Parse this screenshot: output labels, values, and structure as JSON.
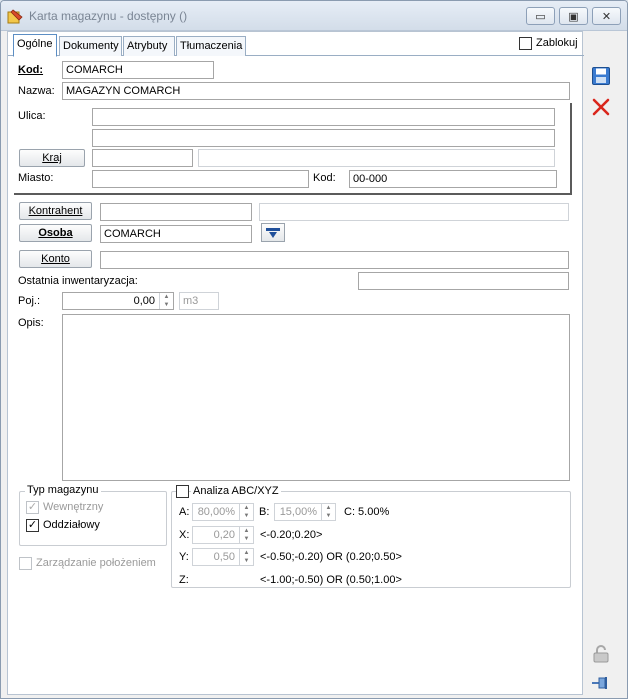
{
  "window": {
    "title": "Karta magazynu - dostępny ()",
    "minimize_glyph": "▭",
    "maximize_glyph": "▣",
    "close_glyph": "✕"
  },
  "tabs": [
    {
      "label": "Ogólne",
      "active": true
    },
    {
      "label": "Dokumenty",
      "active": false
    },
    {
      "label": "Atrybuty",
      "active": false
    },
    {
      "label": "Tłumaczenia",
      "active": false
    }
  ],
  "zablokuj": {
    "label": "Zablokuj",
    "checked": false
  },
  "kod": {
    "label": "Kod:",
    "value": "COMARCH"
  },
  "nazwa": {
    "label": "Nazwa:",
    "value": "MAGAZYN COMARCH"
  },
  "ulica": {
    "label": "Ulica:",
    "line1": "",
    "line2": ""
  },
  "kraj": {
    "button": "Kraj",
    "code": "",
    "name": ""
  },
  "miasto": {
    "label": "Miasto:",
    "value": ""
  },
  "kod_pocztowy": {
    "label": "Kod:",
    "value": "00-000"
  },
  "kontrahent": {
    "button": "Kontrahent",
    "code": "",
    "name": ""
  },
  "osoba": {
    "button": "Osoba",
    "value": "COMARCH"
  },
  "konto": {
    "button": "Konto",
    "value": ""
  },
  "ostatnia_inwentaryzacja": {
    "label": "Ostatnia inwentaryzacja:",
    "value": ""
  },
  "poj": {
    "label": "Poj.:",
    "value": "0,00",
    "unit": "m3"
  },
  "opis": {
    "label": "Opis:",
    "value": ""
  },
  "typ_magazynu": {
    "title": "Typ magazynu",
    "wewnetrzny": {
      "label": "Wewnętrzny",
      "checked": true,
      "disabled": true
    },
    "oddzialowy": {
      "label": "Oddziałowy",
      "checked": true,
      "disabled": false
    }
  },
  "zarzadzanie": {
    "label": "Zarządzanie położeniem",
    "checked": false,
    "disabled": true
  },
  "analiza": {
    "title": "Analiza ABC/XYZ",
    "checked": false,
    "a_label": "A:",
    "a_value": "80,00%",
    "b_label": "B:",
    "b_value": "15,00%",
    "c_text": "C: 5.00%",
    "x_label": "X:",
    "x_value": "0,20",
    "x_range": "<-0.20;0.20>",
    "y_label": "Y:",
    "y_value": "0,50",
    "y_range": "<-0.50;-0.20) OR (0.20;0.50>",
    "z_label": "Z:",
    "z_range": "<-1.00;-0.50) OR (0.50;1.00>"
  },
  "colors": {
    "accent": "#2f6fb5",
    "delete_red": "#d9261c"
  }
}
